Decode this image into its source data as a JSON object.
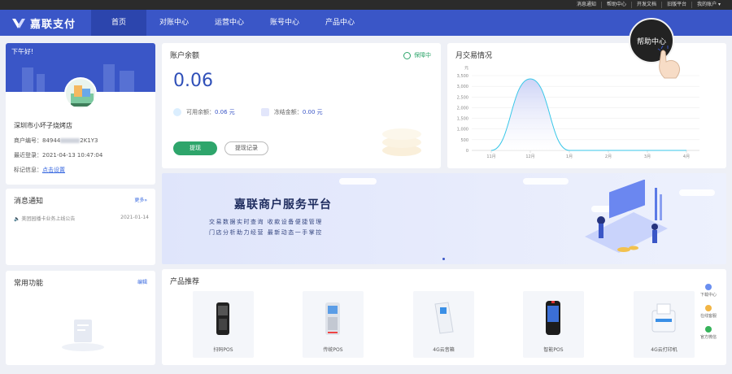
{
  "topbar": {
    "links": [
      "消息通知",
      "帮助中心",
      "开发文档",
      "旧版平台",
      "我的账户 ▾"
    ]
  },
  "nav": {
    "brand": "嘉联支付",
    "items": [
      "首页",
      "对账中心",
      "运营中心",
      "账号中心",
      "产品中心"
    ],
    "active": "首页"
  },
  "welcome": {
    "greeting": "下午好!",
    "shop_name": "深圳市小坏子烧烤店",
    "merchant_no_label": "商户编号：",
    "merchant_no_prefix": "84944",
    "merchant_no_suffix": "2K1Y3",
    "last_login_label": "最近登录：",
    "last_login": "2021-04-13 10:47:04",
    "tag_label": "标记信息：",
    "tag_link": "点击设置"
  },
  "messages": {
    "title": "消息通知",
    "more": "更多»",
    "items": [
      {
        "text": "美团园播卡业务上线公告",
        "date": "2021-01-14"
      }
    ]
  },
  "functions": {
    "title": "常用功能",
    "edit": "编辑"
  },
  "balance": {
    "title": "账户余额",
    "badge": "保障中",
    "amount": "0.06",
    "available_label": "可用余额：",
    "available": "0.06 元",
    "frozen_label": "冻结金额：",
    "frozen": "0.00 元",
    "withdraw": "提现",
    "record": "提现记录"
  },
  "chart_data": {
    "type": "area",
    "title": "月交易情况",
    "ylabel": "元",
    "categories": [
      "11月",
      "12月",
      "1月",
      "2月",
      "3月",
      "4月"
    ],
    "values": [
      0,
      3350,
      0,
      0,
      0,
      0
    ],
    "yticks": [
      0,
      500,
      1000,
      1500,
      2000,
      2500,
      3000,
      3500
    ],
    "ylim": [
      0,
      3500
    ],
    "colors": {
      "line": "#38c7e8",
      "fill": "#c7cef5"
    }
  },
  "promo": {
    "headline": "嘉联商户服务平台",
    "line1": "交易数据实时查询    收款设备便捷管理",
    "line2": "门店分析助力经营    最新动态一手掌控"
  },
  "products": {
    "title": "产品推荐",
    "items": [
      "扫码POS",
      "传统POS",
      "4G云音箱",
      "智能POS",
      "4G云打印机"
    ]
  },
  "side": {
    "items": [
      "下载中心",
      "在线客服",
      "官方微信"
    ]
  },
  "help_bubble": "帮助中心",
  "colors": {
    "brand": "#3a56c7",
    "green": "#2ea56b",
    "link": "#3a6ae0"
  }
}
